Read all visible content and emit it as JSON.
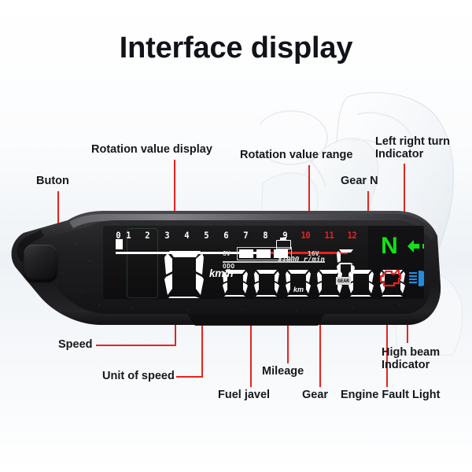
{
  "page": {
    "title": "Interface display",
    "background_color": "#ffffff",
    "leader_color": "#e8231e"
  },
  "callouts": [
    {
      "id": "buton",
      "label": "Buton"
    },
    {
      "id": "rotation-display",
      "label": "Rotation value display"
    },
    {
      "id": "rotation-range",
      "label": "Rotation value range"
    },
    {
      "id": "gear-n",
      "label": "Gear N"
    },
    {
      "id": "turn-indicator",
      "label": "Left right turn\nIndicator"
    },
    {
      "id": "speed",
      "label": "Speed"
    },
    {
      "id": "unit-of-speed",
      "label": "Unit of speed"
    },
    {
      "id": "fuel-javel",
      "label": "Fuel javel"
    },
    {
      "id": "mileage",
      "label": "Mileage"
    },
    {
      "id": "gear",
      "label": "Gear"
    },
    {
      "id": "engine-fault",
      "label": "Engine Fault Light"
    },
    {
      "id": "high-beam",
      "label": "High beam\nIndicator"
    }
  ],
  "device": {
    "type": "motorcycle-lcd-speedometer",
    "housing_color": "#1b1b1d",
    "button": {
      "name": "mode-button",
      "shape": "rounded-square"
    },
    "lcd": {
      "background_color": "#121214",
      "tachometer": {
        "label": "Rotation value display",
        "unit": "x1000 r/min",
        "ticks": [
          "0",
          "1",
          "2",
          "3",
          "4",
          "5",
          "6",
          "7",
          "8",
          "9",
          "10",
          "11",
          "12"
        ],
        "redline_starts_at": "10",
        "normal_color": "#ffffff",
        "redline_color": "#e8231e",
        "current_value": 0
      },
      "speed": {
        "value": "0",
        "unit": "km/h",
        "color": "#ffffff"
      },
      "battery": {
        "min_label": "8V",
        "max_label": "16V",
        "segments_total": 3,
        "segments_filled": 3,
        "icon": "battery-icon"
      },
      "odometer": {
        "mode_label": "ODO",
        "value": "000000",
        "unit": "km"
      },
      "gear": {
        "value": "6",
        "tag": "GEAR"
      },
      "indicators": [
        {
          "id": "neutral",
          "glyph": "N",
          "color": "#12e215",
          "label": "Gear N"
        },
        {
          "id": "turn-signal",
          "glyph": "double-arrow",
          "color": "#12e215",
          "label": "Left right turn Indicator"
        },
        {
          "id": "engine-fault",
          "glyph": "engine-outline",
          "color": "#e8231e",
          "label": "Engine Fault Light"
        },
        {
          "id": "high-beam",
          "glyph": "high-beam-lamp",
          "color": "#1f8fe0",
          "label": "High beam Indicator"
        }
      ]
    }
  }
}
